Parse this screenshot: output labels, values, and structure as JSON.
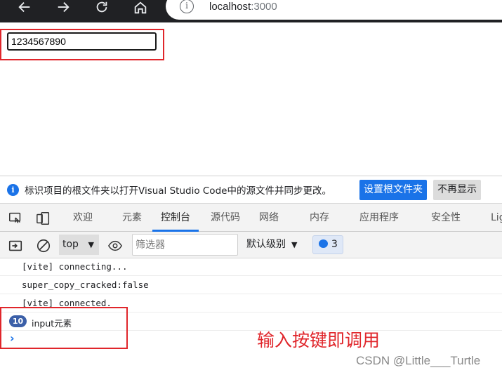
{
  "browser": {
    "url_host": "localhost",
    "url_port": ":3000",
    "back_icon": "back-arrow-icon",
    "forward_icon": "forward-arrow-icon",
    "reload_icon": "reload-icon",
    "home_icon": "home-icon",
    "info_icon": "i"
  },
  "page": {
    "input_value": "1234567890"
  },
  "devtools": {
    "infobar": {
      "icon": "i",
      "message": "标识项目的根文件夹以打开Visual Studio Code中的源文件并同步更改。",
      "primary_button": "设置根文件夹",
      "secondary_button": "不再显示"
    },
    "tabs": [
      {
        "label": "欢迎"
      },
      {
        "label": "元素"
      },
      {
        "label": "控制台"
      },
      {
        "label": "源代码"
      },
      {
        "label": "网络"
      },
      {
        "label": "内存"
      },
      {
        "label": "应用程序"
      },
      {
        "label": "安全性"
      },
      {
        "label": "Lig"
      }
    ],
    "toolbar": {
      "context": "top",
      "filter_placeholder": "筛选器",
      "levels": "默认级别",
      "issues_count": "3"
    },
    "console": {
      "lines": [
        {
          "text": "[vite] connecting..."
        },
        {
          "text": "super_copy_cracked:false"
        },
        {
          "text": "[vite] connected."
        },
        {
          "count": "10",
          "text": "input元素"
        }
      ],
      "prompt": "›"
    }
  },
  "annotation": "输入按键即调用",
  "watermark": "CSDN @Little___Turtle",
  "colors": {
    "highlight": "#e0262b",
    "accent": "#1a73e8",
    "count_badge": "#3b5fa8"
  }
}
